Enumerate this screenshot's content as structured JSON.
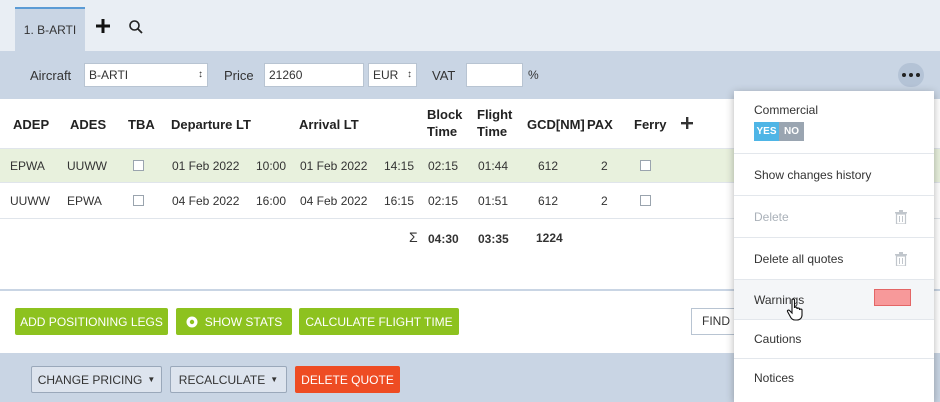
{
  "tabs": {
    "active": "1. B-ARTI",
    "add_icon": "plus-icon",
    "search_icon": "search-icon"
  },
  "params": {
    "aircraft_label": "Aircraft",
    "aircraft_value": "B-ARTI",
    "price_label": "Price",
    "price_value": "21260",
    "currency_value": "EUR",
    "vat_label": "VAT",
    "vat_value": "",
    "vat_unit": "%",
    "more_icon": "more-horizontal-icon"
  },
  "table": {
    "headers": {
      "adep": "ADEP",
      "ades": "ADES",
      "tba": "TBA",
      "departure": "Departure LT",
      "arrival": "Arrival LT",
      "block_1": "Block",
      "block_2": "Time",
      "flight_1": "Flight",
      "flight_2": "Time",
      "gcd": "GCD[NM]",
      "pax": "PAX",
      "ferry": "Ferry",
      "add_icon": "plus-icon"
    },
    "rows": [
      {
        "adep": "EPWA",
        "ades": "UUWW",
        "tba": false,
        "dep_date": "01 Feb 2022",
        "dep_time": "10:00",
        "arr_date": "01 Feb 2022",
        "arr_time": "14:15",
        "block": "02:15",
        "flight": "01:44",
        "gcd": "612",
        "pax": "2",
        "ferry": false
      },
      {
        "adep": "UUWW",
        "ades": "EPWA",
        "tba": false,
        "dep_date": "04 Feb 2022",
        "dep_time": "16:00",
        "arr_date": "04 Feb 2022",
        "arr_time": "16:15",
        "block": "02:15",
        "flight": "01:51",
        "gcd": "612",
        "pax": "2",
        "ferry": false
      }
    ],
    "totals": {
      "sigma": "Σ",
      "block": "04:30",
      "flight": "03:35",
      "gcd": "1224"
    }
  },
  "actions": {
    "add_positioning": "ADD POSITIONING LEGS",
    "show_stats": "SHOW STATS",
    "calc_flight_time": "CALCULATE FLIGHT TIME",
    "find": "FIND S"
  },
  "bottom": {
    "change_pricing": "CHANGE PRICING",
    "recalculate": "RECALCULATE",
    "delete_quote": "DELETE QUOTE"
  },
  "menu": {
    "commercial": "Commercial",
    "toggle_yes": "YES",
    "toggle_no": "NO",
    "show_history": "Show changes history",
    "delete": "Delete",
    "delete_all": "Delete all quotes",
    "warnings": "Warnings",
    "warnings_color": "#f7999a",
    "cautions": "Cautions",
    "notices": "Notices"
  },
  "colors": {
    "tab_accent": "#5b9bd5",
    "panel_bg": "#c9d5e4",
    "selected_row": "#e8f1dd",
    "green_button": "#8dc21f",
    "red_button": "#ee4c23",
    "toggle_yes": "#4eb5e6"
  }
}
